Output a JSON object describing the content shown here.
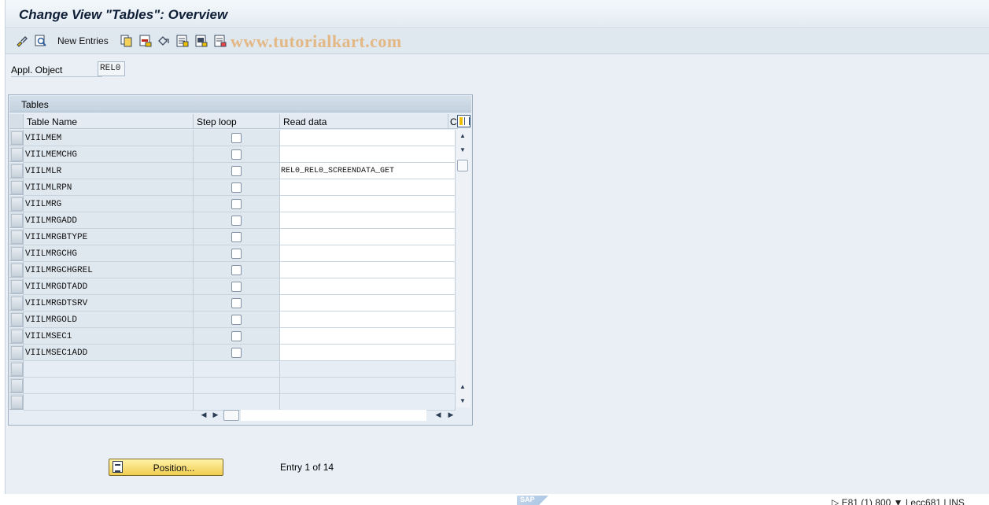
{
  "window": {
    "title": "Change View \"Tables\": Overview"
  },
  "toolbar": {
    "icons": [
      "display-change-icon",
      "find-icon",
      "copy-as-icon",
      "delete-icon",
      "undo-change-icon",
      "select-all-icon",
      "select-block-icon",
      "deselect-all-icon"
    ],
    "new_entries_label": "New Entries",
    "watermark": "www.tutorialkart.com"
  },
  "appl_object": {
    "label": "Appl. Object",
    "value": "REL0"
  },
  "table": {
    "title": "Tables",
    "columns": [
      "Table Name",
      "Step loop",
      "Read data",
      "C"
    ],
    "rows": [
      {
        "name": "VIILMEM",
        "step_loop": false,
        "read_data": ""
      },
      {
        "name": "VIILMEMCHG",
        "step_loop": false,
        "read_data": ""
      },
      {
        "name": "VIILMLR",
        "step_loop": false,
        "read_data": "REL0_REL0_SCREENDATA_GET"
      },
      {
        "name": "VIILMLRPN",
        "step_loop": false,
        "read_data": ""
      },
      {
        "name": "VIILMRG",
        "step_loop": false,
        "read_data": ""
      },
      {
        "name": "VIILMRGADD",
        "step_loop": false,
        "read_data": ""
      },
      {
        "name": "VIILMRGBTYPE",
        "step_loop": false,
        "read_data": ""
      },
      {
        "name": "VIILMRGCHG",
        "step_loop": false,
        "read_data": ""
      },
      {
        "name": "VIILMRGCHGREL",
        "step_loop": false,
        "read_data": ""
      },
      {
        "name": "VIILMRGDTADD",
        "step_loop": false,
        "read_data": ""
      },
      {
        "name": "VIILMRGDTSRV",
        "step_loop": false,
        "read_data": ""
      },
      {
        "name": "VIILMRGOLD",
        "step_loop": false,
        "read_data": ""
      },
      {
        "name": "VIILMSEC1",
        "step_loop": false,
        "read_data": ""
      },
      {
        "name": "VIILMSEC1ADD",
        "step_loop": false,
        "read_data": ""
      }
    ]
  },
  "footer": {
    "position_button": "Position...",
    "entry_text": "Entry 1 of 14"
  },
  "statusbar": {
    "logo": "SAP",
    "session": "E81 (1) 800",
    "server": "ecc681",
    "mode": "INS"
  },
  "colors": {
    "accent_button": "#f0cd50",
    "background": "#e9eff5"
  }
}
